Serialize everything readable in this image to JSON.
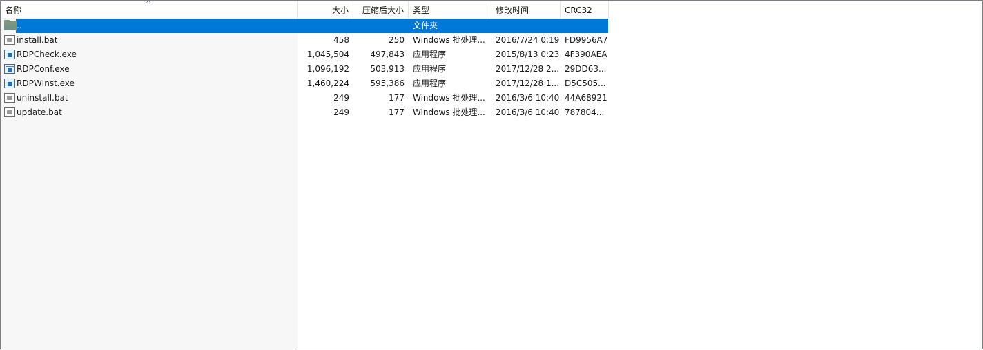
{
  "columns": {
    "name": "名称",
    "size": "大小",
    "packed": "压缩后大小",
    "type": "类型",
    "modified": "修改时间",
    "crc": "CRC32"
  },
  "sort": {
    "column": "name",
    "direction": "ascending",
    "icon": "chevron-up-icon"
  },
  "rows": [
    {
      "name": "..",
      "size": "",
      "packed": "",
      "type": "文件夹",
      "modified": "",
      "crc": "",
      "icon": "folder-up-icon",
      "selected": true
    },
    {
      "name": "install.bat",
      "size": "458",
      "packed": "250",
      "type": "Windows 批处理...",
      "modified": "2016/7/24 0:19",
      "crc": "FD9956A7",
      "icon": "batch-file-icon"
    },
    {
      "name": "RDPCheck.exe",
      "size": "1,045,504",
      "packed": "497,843",
      "type": "应用程序",
      "modified": "2015/8/13 0:23",
      "crc": "4F390AEA",
      "icon": "application-icon"
    },
    {
      "name": "RDPConf.exe",
      "size": "1,096,192",
      "packed": "503,913",
      "type": "应用程序",
      "modified": "2017/12/28 2...",
      "crc": "29DD63...",
      "icon": "application-icon"
    },
    {
      "name": "RDPWInst.exe",
      "size": "1,460,224",
      "packed": "595,386",
      "type": "应用程序",
      "modified": "2017/12/28 1...",
      "crc": "D5C505...",
      "icon": "application-icon"
    },
    {
      "name": "uninstall.bat",
      "size": "249",
      "packed": "177",
      "type": "Windows 批处理...",
      "modified": "2016/3/6 10:40",
      "crc": "44A68921",
      "icon": "batch-file-icon"
    },
    {
      "name": "update.bat",
      "size": "249",
      "packed": "177",
      "type": "Windows 批处理...",
      "modified": "2016/3/6 10:40",
      "crc": "787804...",
      "icon": "batch-file-icon"
    }
  ],
  "colors": {
    "selection": "#0078d7",
    "name_column_bg": "#f7f7f7",
    "border": "#7a7e83"
  }
}
